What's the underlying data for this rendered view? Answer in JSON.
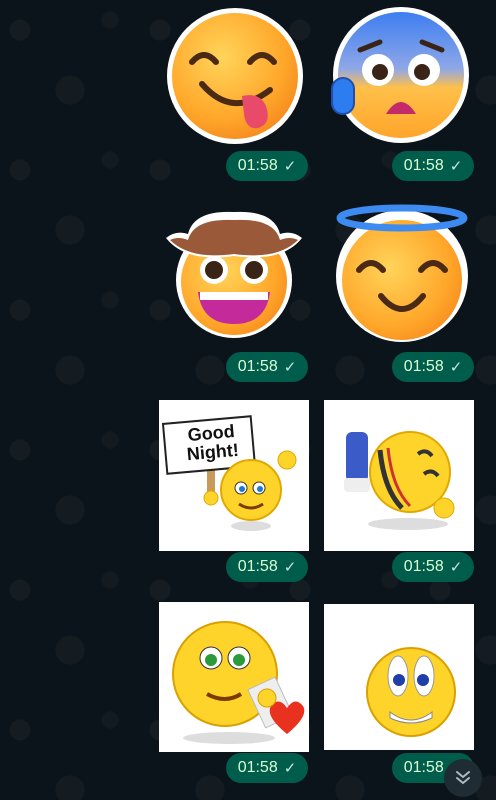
{
  "messages": [
    {
      "time": "01:58",
      "status_icon": "single-check-icon"
    },
    {
      "time": "01:58",
      "status_icon": "single-check-icon"
    },
    {
      "time": "01:58",
      "status_icon": "single-check-icon"
    },
    {
      "time": "01:58",
      "status_icon": "single-check-icon"
    },
    {
      "time": "01:58",
      "status_icon": "single-check-icon"
    },
    {
      "time": "01:58",
      "status_icon": "single-check-icon"
    },
    {
      "time": "01:58",
      "status_icon": "single-check-icon"
    },
    {
      "time": "01:58",
      "status_icon": "single-check-icon"
    }
  ],
  "stickers": {
    "good_night_sign": "Good\nNight!"
  },
  "check_glyph": "✓",
  "colors": {
    "background": "#0b141a",
    "pill": "#005c4b",
    "pill_text": "#d9fdd3"
  },
  "scroll_button_icon": "double-chevron-down-icon"
}
